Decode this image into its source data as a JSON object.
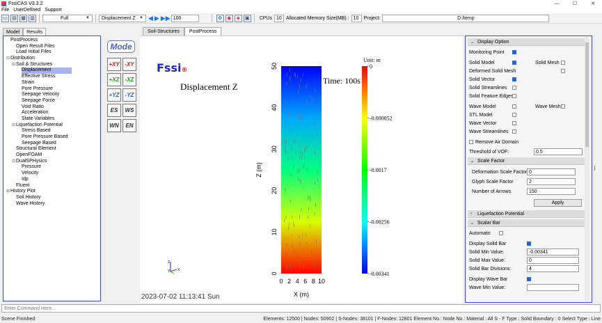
{
  "window": {
    "title": "FssiCAS V3.3.2"
  },
  "menu": [
    "File",
    "UserDefined",
    "Support"
  ],
  "toolbar": {
    "view_mode": "Full",
    "field_mode": "Displacement Z",
    "frame": "100",
    "cpus_label": "CPUs",
    "cpus_value": "10",
    "memory_label": "Allocated Memory Size(MB) :",
    "memory_value": "10",
    "project_label": "Project:",
    "project_value": "D:/temp"
  },
  "left_tabs": [
    "Model",
    "Results"
  ],
  "tree": [
    {
      "label": "PostProcess",
      "indent": 0,
      "exp": ""
    },
    {
      "label": "Open Result Files",
      "indent": 1,
      "exp": ""
    },
    {
      "label": "Load Initial Files",
      "indent": 1,
      "exp": ""
    },
    {
      "label": "Distribution",
      "indent": 0,
      "exp": "-"
    },
    {
      "label": "Soil & Structures",
      "indent": 1,
      "exp": "-"
    },
    {
      "label": "Displacement",
      "indent": 2,
      "exp": "",
      "selected": true
    },
    {
      "label": "Effective Stress",
      "indent": 2,
      "exp": ""
    },
    {
      "label": "Strain",
      "indent": 2,
      "exp": ""
    },
    {
      "label": "Pore Pressure",
      "indent": 2,
      "exp": ""
    },
    {
      "label": "Seepage Velocity",
      "indent": 2,
      "exp": ""
    },
    {
      "label": "Seepage Force",
      "indent": 2,
      "exp": ""
    },
    {
      "label": "Void Ratio",
      "indent": 2,
      "exp": ""
    },
    {
      "label": "Acceleration",
      "indent": 2,
      "exp": ""
    },
    {
      "label": "State Variables",
      "indent": 2,
      "exp": ""
    },
    {
      "label": "Liquefaction Potential",
      "indent": 1,
      "exp": "-"
    },
    {
      "label": "Stress Based",
      "indent": 2,
      "exp": ""
    },
    {
      "label": "Pore Pressure Based",
      "indent": 2,
      "exp": ""
    },
    {
      "label": "Seepage Based",
      "indent": 2,
      "exp": ""
    },
    {
      "label": "Structural Element",
      "indent": 1,
      "exp": ""
    },
    {
      "label": "OpenFOAM",
      "indent": 1,
      "exp": ""
    },
    {
      "label": "DualSPHysics",
      "indent": 1,
      "exp": "-"
    },
    {
      "label": "Pressure",
      "indent": 2,
      "exp": ""
    },
    {
      "label": "Velocity",
      "indent": 2,
      "exp": ""
    },
    {
      "label": "Idp",
      "indent": 2,
      "exp": ""
    },
    {
      "label": "Fluent",
      "indent": 1,
      "exp": ""
    },
    {
      "label": "History Plot",
      "indent": 0,
      "exp": "+"
    },
    {
      "label": "Soil History",
      "indent": 1,
      "exp": ""
    },
    {
      "label": "Wave History",
      "indent": 1,
      "exp": ""
    }
  ],
  "tool_buttons": {
    "mode": "Mode",
    "axes": [
      "+XY",
      "-XY",
      "+XZ",
      "-XZ",
      "+YZ",
      "-YZ",
      "ES",
      "WS",
      "WN",
      "EN"
    ]
  },
  "view_tabs": [
    "Soil-Structures",
    "PostProcess"
  ],
  "viewport": {
    "logo": "Fssi",
    "field_title": "Displacement Z",
    "time": "Time: 100s",
    "unit": "Unit:  m",
    "timestamp": "2023-07-02 11:13:41 Sun",
    "triad_axes": [
      "Z",
      "Y",
      "X"
    ]
  },
  "chart_data": {
    "type": "heatmap",
    "title": "Displacement Z",
    "xlabel": "X (m)",
    "ylabel": "Z (m)",
    "xlim": [
      0,
      10
    ],
    "ylim": [
      0,
      50
    ],
    "x_ticks": [
      "0",
      "2",
      "4",
      "6",
      "8",
      "10"
    ],
    "y_ticks": [
      "0",
      "10",
      "20",
      "30",
      "40",
      "50"
    ],
    "colorbar": {
      "min": -0.00341,
      "max": 0,
      "tick_labels": [
        "0",
        "-0.000852",
        "-0.0017",
        "-0.00256",
        "-0.00341"
      ],
      "colors": [
        "#ff0000",
        "#ffff00",
        "#00ff00",
        "#00ffff",
        "#0000ff"
      ]
    },
    "field_gradient": {
      "top": -0.00341,
      "bottom": 0
    }
  },
  "panel": {
    "display_option": {
      "header": "Display Option",
      "monitoring_point": "Monitoring Point",
      "solid_model": "Solid Model",
      "solid_mesh": "Solid Mesh",
      "deformed_mesh": "Deformed Solid Mesh",
      "solid_vector": "Solid Vector",
      "solid_streamlines": "Solid Streamlines",
      "solid_feature_edges": "Solid Feature Edges",
      "wave_model": "Wave Model",
      "wave_mesh": "Wave Mesh",
      "stl_model": "STL Model",
      "wave_vector": "Wave Vector",
      "wave_streamlines": "Wave Streamlines",
      "remove_air": "Remove Air Domain",
      "threshold_label": "Threshold of VOF:",
      "threshold_value": "0.5"
    },
    "scale_factor": {
      "header": "Scale Factor",
      "deformation_label": "Deformation Scale Factor",
      "deformation_value": "0",
      "glyph_label": "Glyph Scale Factor",
      "glyph_value": "2",
      "arrows_label": "Number of Arrows",
      "arrows_value": "150",
      "apply": "Apply"
    },
    "liquefaction": {
      "header": "Liquefaction Potential"
    },
    "scalar_bar": {
      "header": "Scalar Bar",
      "automatic": "Automatic",
      "display_solid_bar": "Display Solid Bar",
      "solid_min_label": "Solid Min Value:",
      "solid_min_value": "-0.00341",
      "solid_max_label": "Solid Max Value:",
      "solid_max_value": "0",
      "solid_div_label": "Solid Bar Divisions:",
      "solid_div_value": "4",
      "display_wave_bar": "Display Wave Bar",
      "wave_min_label": "Wave Min Value:"
    }
  },
  "command": {
    "placeholder": "Enter Command Here..."
  },
  "status": {
    "left": "Scene Finished",
    "right": "Elements: 12500 | Nodes: 50902 | S-Nodes: 38101 | F-Nodes: 12801 Element No.:   Node No.:   Material :  All   S - F Type :  Solid   Boundary :  0   Select Type :  Line"
  }
}
